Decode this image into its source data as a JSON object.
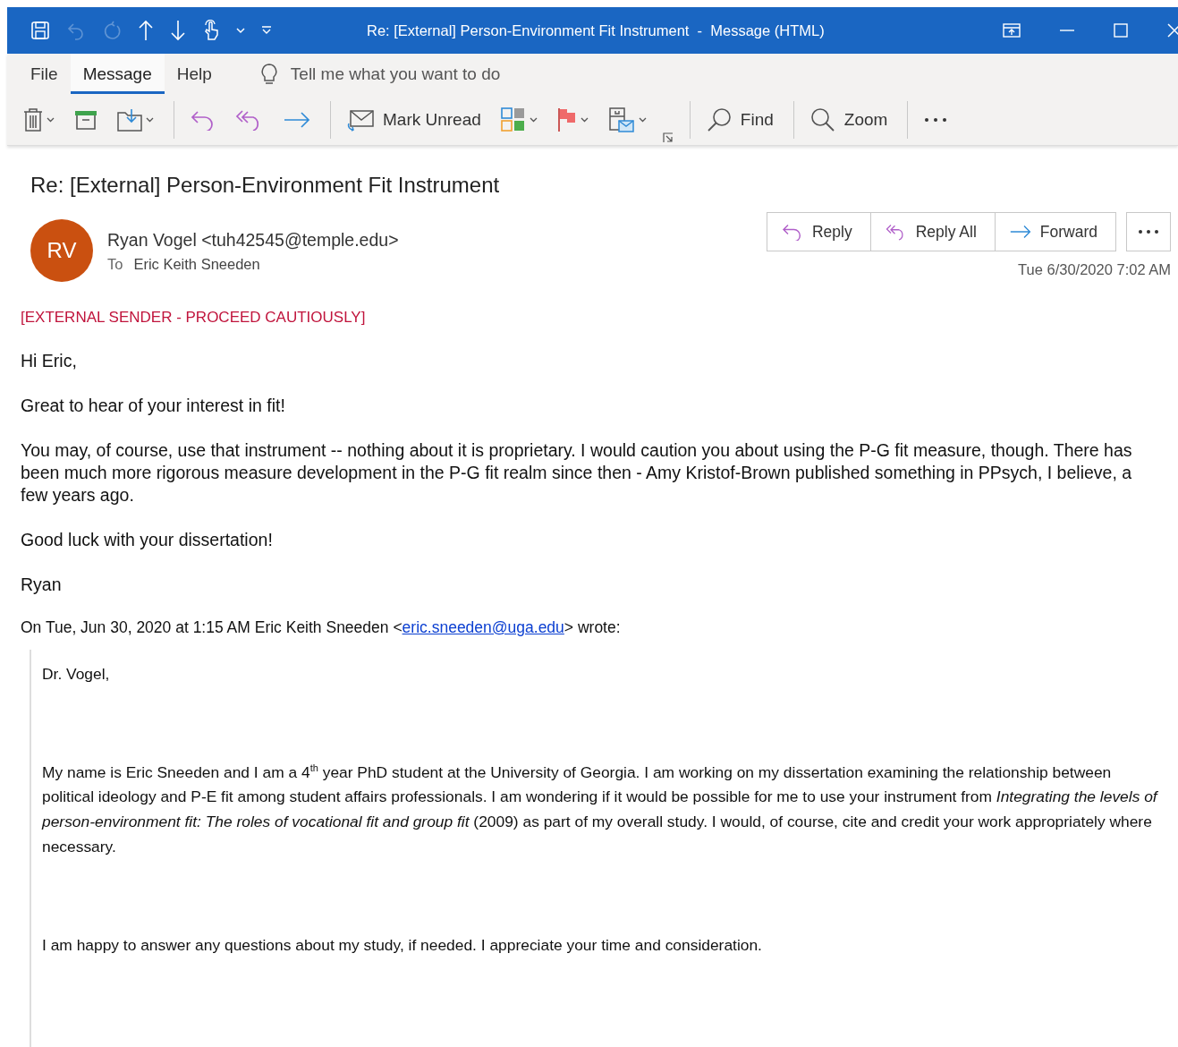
{
  "title_bar": {
    "title": "Re: [External] Person-Environment Fit Instrument  -  Message (HTML)",
    "quick_access": [
      {
        "kind": "save",
        "disabled": false
      },
      {
        "kind": "undo",
        "disabled": true
      },
      {
        "kind": "redo",
        "disabled": true
      },
      {
        "kind": "up",
        "disabled": false
      },
      {
        "kind": "down",
        "disabled": false
      },
      {
        "kind": "touch",
        "disabled": false
      },
      {
        "kind": "chevron",
        "disabled": false
      },
      {
        "kind": "customize",
        "disabled": false
      }
    ],
    "window_controls": [
      {
        "kind": "display-options"
      },
      {
        "kind": "minimize"
      },
      {
        "kind": "maximize"
      },
      {
        "kind": "close"
      }
    ]
  },
  "ribbon_tabs": [
    {
      "label": "File",
      "selected": false
    },
    {
      "label": "Message",
      "selected": true
    },
    {
      "label": "Help",
      "selected": false
    }
  ],
  "tell_me": {
    "placeholder": "Tell me what you want to do"
  },
  "toolbar": [
    {
      "kind": "delete",
      "dropdown": true
    },
    {
      "kind": "archive",
      "dropdown": false
    },
    {
      "kind": "move",
      "dropdown": true
    },
    {
      "kind": "separator"
    },
    {
      "kind": "reply",
      "dropdown": false
    },
    {
      "kind": "reply-all",
      "dropdown": false
    },
    {
      "kind": "forward",
      "dropdown": false
    },
    {
      "kind": "separator"
    },
    {
      "kind": "mark-unread",
      "label": "Mark Unread",
      "dropdown": false
    },
    {
      "kind": "categorize",
      "dropdown": true
    },
    {
      "kind": "flag",
      "dropdown": true
    },
    {
      "kind": "rules",
      "dropdown": true
    },
    {
      "kind": "launcher"
    },
    {
      "kind": "separator"
    },
    {
      "kind": "find",
      "label": "Find",
      "dropdown": false
    },
    {
      "kind": "separator"
    },
    {
      "kind": "zoom",
      "label": "Zoom",
      "dropdown": false
    },
    {
      "kind": "separator"
    },
    {
      "kind": "more",
      "dropdown": false
    }
  ],
  "message": {
    "subject": "Re: [External] Person-Environment Fit Instrument",
    "sender": {
      "initials": "RV",
      "name": "Ryan Vogel <tuh42545@temple.edu>"
    },
    "to_label": "To",
    "to": "Eric Keith Sneeden",
    "actions": [
      {
        "kind": "reply",
        "label": "Reply"
      },
      {
        "kind": "reply-all",
        "label": "Reply All"
      },
      {
        "kind": "forward",
        "label": "Forward"
      },
      {
        "kind": "more"
      }
    ],
    "date": "Tue 6/30/2020 7:02 AM"
  },
  "body": {
    "banner": "[EXTERNAL SENDER - PROCEED CAUTIOUSLY]",
    "paragraphs": [
      "Hi Eric,",
      "Great to hear of your interest in fit!",
      "You may, of course, use that instrument -- nothing about it is proprietary. I would caution you about using the P-G fit measure, though. There has been much more rigorous measure development in the P-G fit realm since then - Amy Kristof-Brown published something in PPsych, I believe, a few years ago.",
      "Good luck with your dissertation!",
      "Ryan"
    ],
    "quote_header": {
      "before": "On Tue, Jun 30, 2020 at 1:15 AM Eric Keith Sneeden <",
      "link": "eric.sneeden@uga.edu",
      "after": "> wrote:"
    },
    "quoted": [
      "Dr. Vogel,",
      "My name is Eric Sneeden and I am a 4$^{th}$ year PhD student at the University of Georgia.  I am working on my dissertation examining the relationship between political ideology and P-E fit among student affairs professionals.  I am wondering if it would be possible for me to use your instrument from *Integrating the levels of person-environment fit: The roles of vocational fit and group fit* (2009) as part of my overall study.  I would, of course, cite and credit your work appropriately where necessary.",
      "I am happy to answer any questions about my study, if needed. I appreciate your time and consideration."
    ]
  }
}
